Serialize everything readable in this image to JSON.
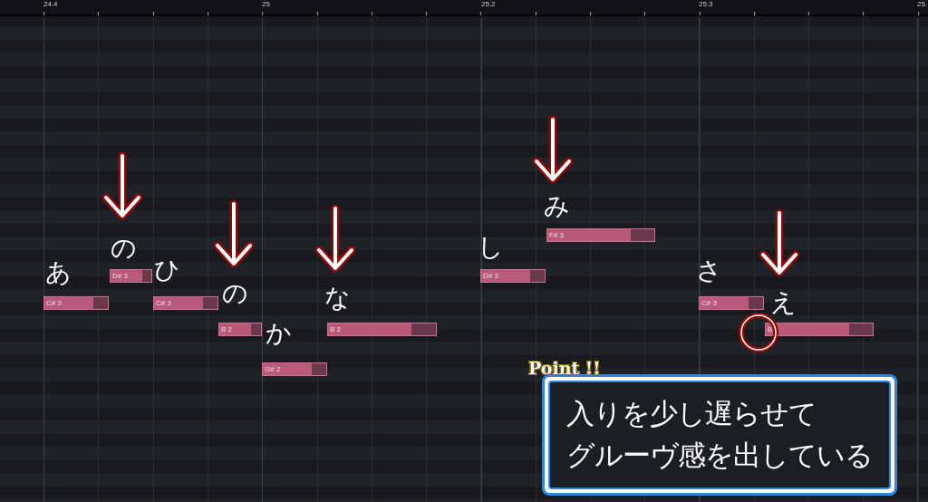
{
  "ruler": {
    "labels": [
      "24.4",
      "25",
      "25.2",
      "25.3",
      "25."
    ]
  },
  "notes": [
    {
      "label": "C# 3",
      "lyric": "あ"
    },
    {
      "label": "D# 3",
      "lyric": "の"
    },
    {
      "label": "C# 3",
      "lyric": "ひ"
    },
    {
      "label": "B 2",
      "lyric": "の"
    },
    {
      "label": "G# 2",
      "lyric": "か"
    },
    {
      "label": "B 2",
      "lyric": "な"
    },
    {
      "label": "D# 3",
      "lyric": "し"
    },
    {
      "label": "F# 3",
      "lyric": "み"
    },
    {
      "label": "C# 3",
      "lyric": "さ"
    },
    {
      "label": "B",
      "lyric": "え"
    }
  ],
  "callout": {
    "badge": "Point !!",
    "lines": [
      "入りを少し遅らせて",
      "グルーヴ感を出している"
    ]
  }
}
